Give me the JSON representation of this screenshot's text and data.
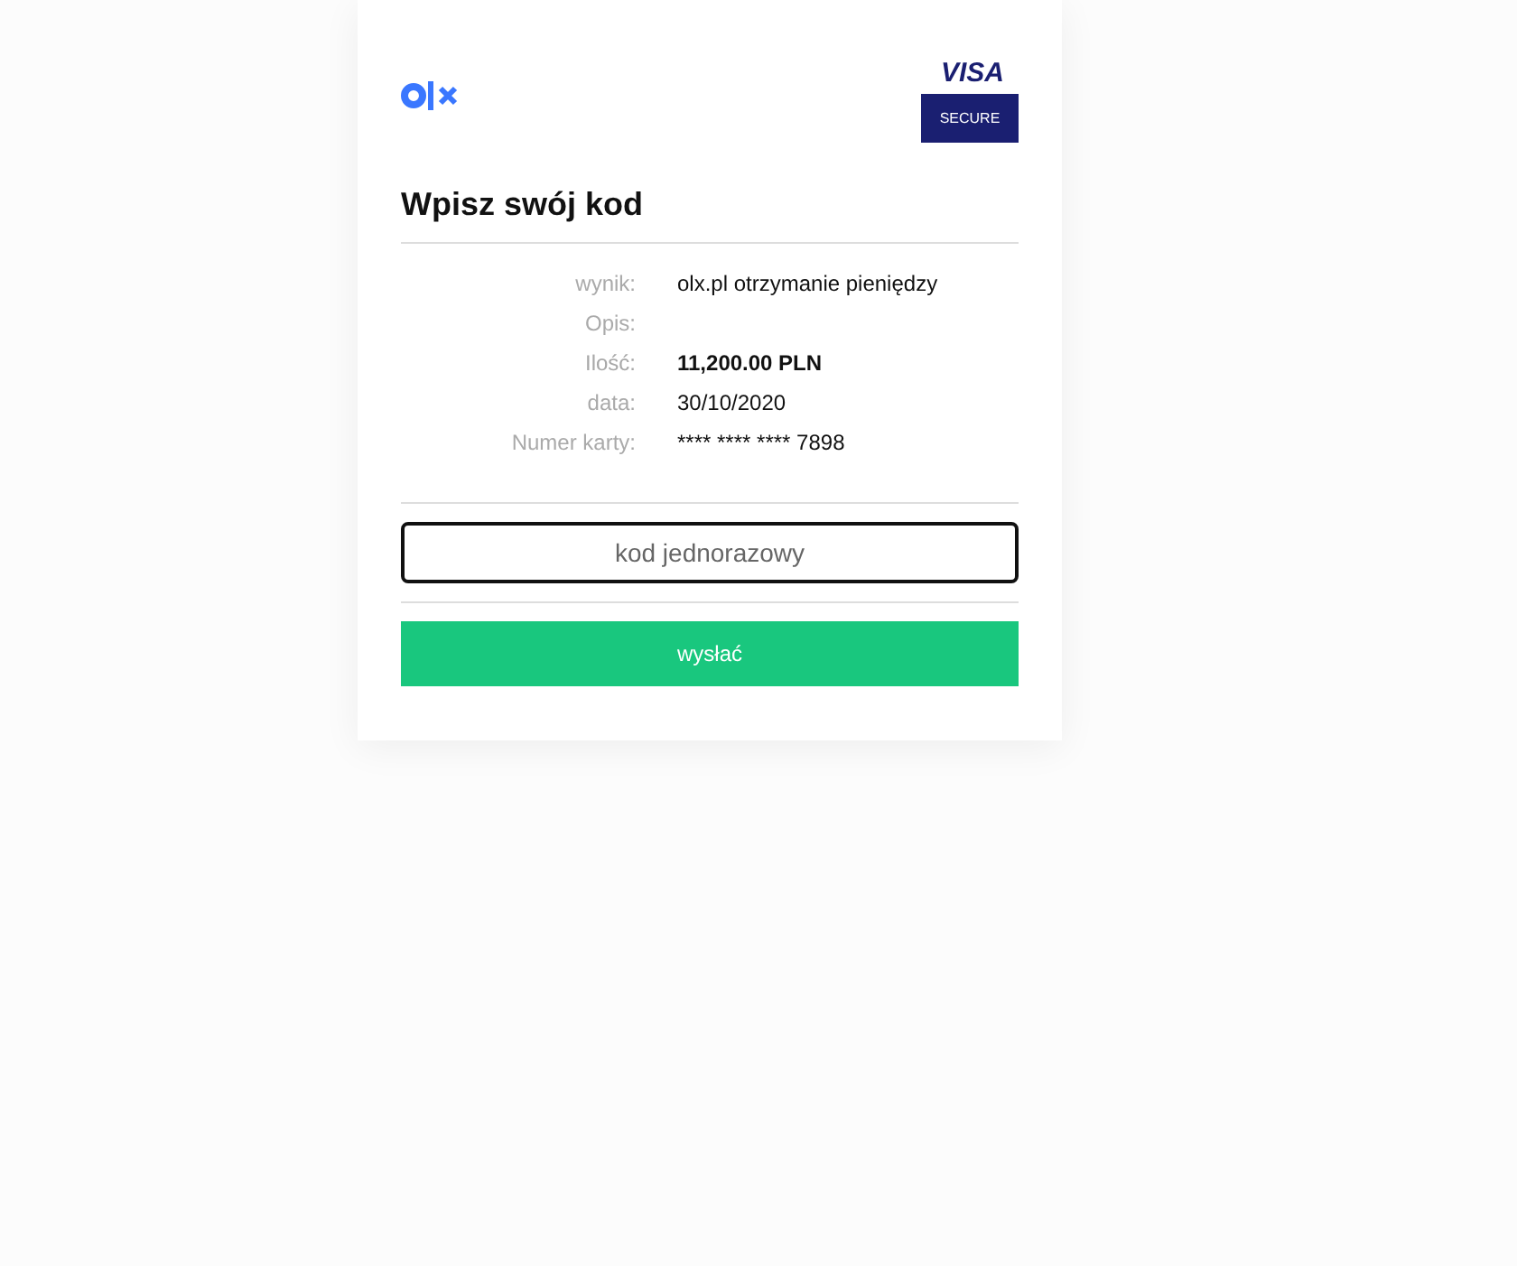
{
  "header": {
    "visa_badge": {
      "brand": "VISA",
      "label": "SECURE"
    }
  },
  "title": "Wpisz swój kod",
  "details": [
    {
      "label": "wynik:",
      "value": "olx.pl otrzymanie pieniędzy",
      "kind": "text"
    },
    {
      "label": "Opis:",
      "kind": "text"
    },
    {
      "label": "Ilość:",
      "value": "11,200.00 PLN",
      "kind": "amount"
    },
    {
      "label": "data:",
      "value": "30/10/2020",
      "kind": "text"
    },
    {
      "label": "Numer karty:",
      "value": "**** **** **** 7898",
      "kind": "text"
    }
  ],
  "code_field": {
    "placeholder": "kod jednorazowy"
  },
  "submit_button": "wysłać"
}
